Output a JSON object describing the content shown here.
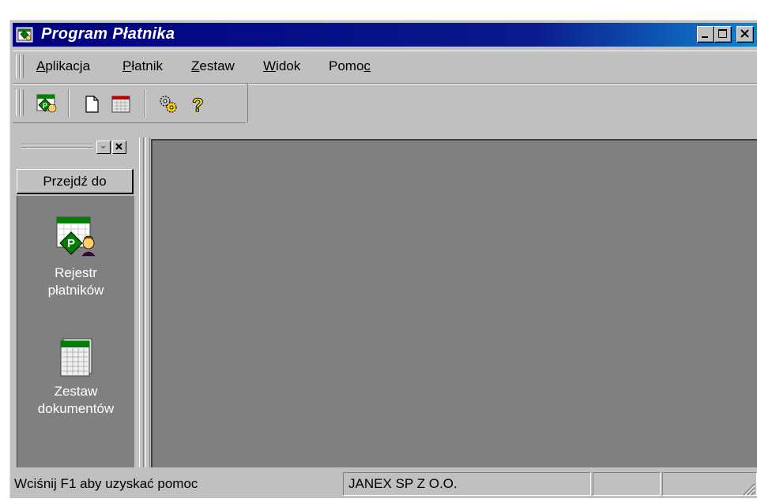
{
  "window": {
    "title": "Program Płatnika",
    "controls": [
      "minimize-icon",
      "maximize-icon",
      "close-icon"
    ]
  },
  "menu": {
    "items": [
      {
        "pre": "",
        "key": "A",
        "post": "plikacja"
      },
      {
        "pre": "",
        "key": "P",
        "post": "łatnik"
      },
      {
        "pre": "",
        "key": "Z",
        "post": "estaw"
      },
      {
        "pre": "",
        "key": "W",
        "post": "idok"
      },
      {
        "pre": "Pomo",
        "key": "c",
        "post": ""
      }
    ]
  },
  "toolbar": {
    "buttons": [
      "payer-register-icon",
      "new-document-icon",
      "document-set-icon",
      "settings-gears-icon",
      "help-question-icon"
    ]
  },
  "panel": {
    "goto_label": "Przejdź do",
    "shortcuts": [
      {
        "line1": "Rejestr",
        "line2": "płatników",
        "icon": "payer-register-icon"
      },
      {
        "line1": "Zestaw",
        "line2": "dokumentów",
        "icon": "document-set-icon"
      }
    ]
  },
  "status": {
    "help_text": "Wciśnij F1 aby uzyskać pomoc",
    "company": "JANEX SP Z O.O.",
    "empty1": "",
    "empty2": ""
  },
  "colors": {
    "titlebar_start": "#000080",
    "titlebar_end": "#1084d0",
    "face": "#c0c0c0",
    "workspace": "#808080"
  }
}
